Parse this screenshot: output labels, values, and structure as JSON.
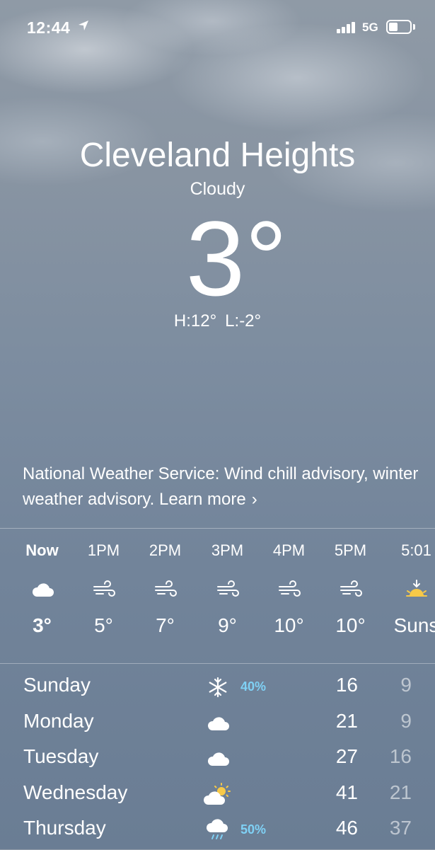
{
  "status_bar": {
    "time": "12:44",
    "network": "5G"
  },
  "location": {
    "city": "Cleveland Heights",
    "condition": "Cloudy",
    "temperature": "3°",
    "high": "H:12°",
    "low": "L:-2°"
  },
  "advisory": {
    "text": "National Weather Service: Wind chill advisory, winter weather advisory. Learn more",
    "chevron": "›"
  },
  "hourly": [
    {
      "time": "Now",
      "icon": "cloud-icon",
      "temp": "3°"
    },
    {
      "time": "1PM",
      "icon": "wind-icon",
      "temp": "5°"
    },
    {
      "time": "2PM",
      "icon": "wind-icon",
      "temp": "7°"
    },
    {
      "time": "3PM",
      "icon": "wind-icon",
      "temp": "9°"
    },
    {
      "time": "4PM",
      "icon": "wind-icon",
      "temp": "10°"
    },
    {
      "time": "5PM",
      "icon": "wind-icon",
      "temp": "10°"
    },
    {
      "time": "5:01",
      "icon": "sunset-icon",
      "temp": "Suns"
    }
  ],
  "daily": [
    {
      "day": "Sunday",
      "icon": "snowflake-icon",
      "precip": "40%",
      "high": "16",
      "low": "9"
    },
    {
      "day": "Monday",
      "icon": "cloud-icon",
      "precip": "",
      "high": "21",
      "low": "9"
    },
    {
      "day": "Tuesday",
      "icon": "cloud-icon",
      "precip": "",
      "high": "27",
      "low": "16"
    },
    {
      "day": "Wednesday",
      "icon": "partly-sunny-icon",
      "precip": "",
      "high": "41",
      "low": "21"
    },
    {
      "day": "Thursday",
      "icon": "rain-icon",
      "precip": "50%",
      "high": "46",
      "low": "37"
    }
  ],
  "colors": {
    "precip": "#7fd1f5",
    "sun": "#f7c948"
  }
}
